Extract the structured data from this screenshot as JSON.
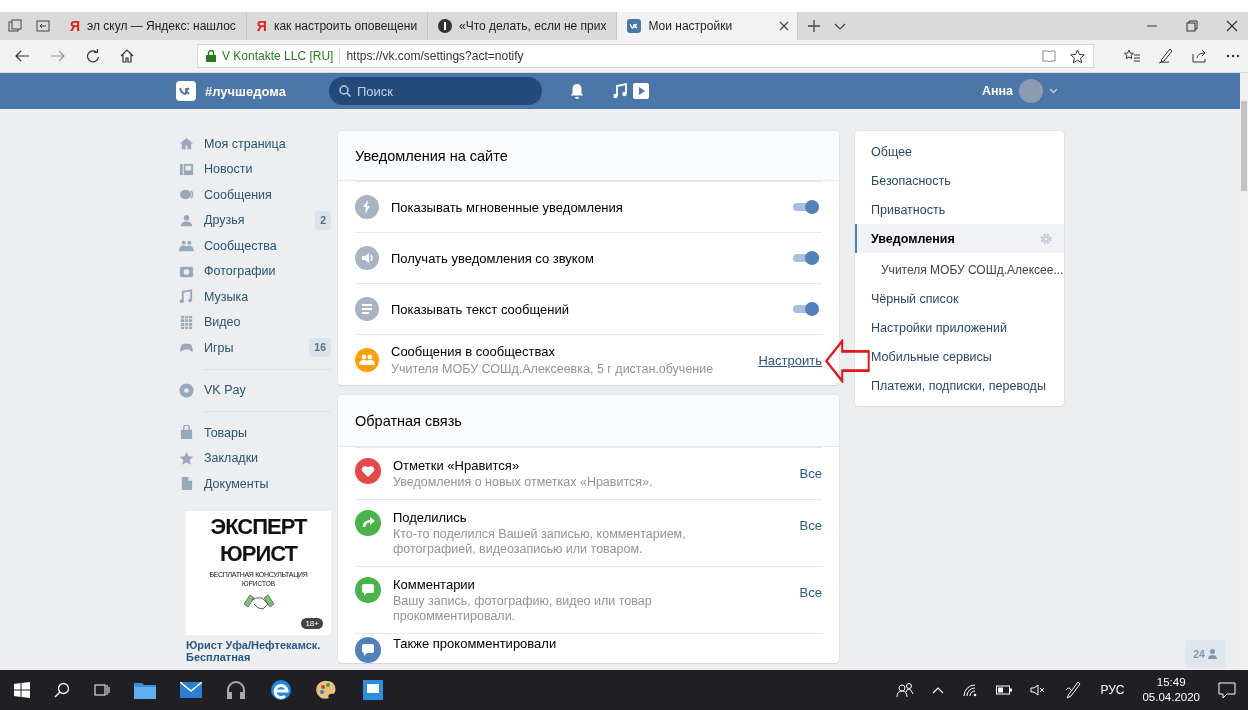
{
  "browser": {
    "tabs": [
      {
        "label": "эл скул — Яндекс: нашлос",
        "kind": "letter",
        "icon_text": "Я",
        "selected": false
      },
      {
        "label": "как настроить оповещени",
        "kind": "letter",
        "icon_text": "Я",
        "selected": false
      },
      {
        "label": "«Что делать, если не прих",
        "kind": "circle",
        "selected": false
      },
      {
        "label": "Мои настройки",
        "kind": "logo",
        "selected": true
      }
    ],
    "site_identity": "V Kontakte LLC [RU]",
    "url": "https://vk.com/settings?act=notify"
  },
  "header": {
    "brand": "#лучшедома",
    "search_placeholder": "Поиск",
    "user_name": "Анна"
  },
  "left_menu": {
    "groups": [
      [
        {
          "label": "Моя страница"
        },
        {
          "label": "Новости"
        },
        {
          "label": "Сообщения"
        },
        {
          "label": "Друзья",
          "count": "2"
        },
        {
          "label": "Сообщества"
        },
        {
          "label": "Фотографии"
        },
        {
          "label": "Музыка"
        },
        {
          "label": "Видео"
        },
        {
          "label": "Игры",
          "count": "16"
        }
      ],
      [
        {
          "label": "VK Pay"
        }
      ],
      [
        {
          "label": "Товары"
        },
        {
          "label": "Закладки"
        },
        {
          "label": "Документы"
        }
      ]
    ]
  },
  "ad": {
    "headline": "ЭКСПЕРТ",
    "headline_2": "ЮРИСТ",
    "tagline": "БЕСПЛАТНАЯ КОНСУЛЬТАЦИЯ",
    "tagline_2": "ЮРИСТОВ",
    "age_badge": "18+",
    "title": "Юрист Уфа/Нефтекамск.",
    "title_2": "Бесплатная"
  },
  "notifications": {
    "title": "Уведомления на сайте",
    "rows": [
      {
        "kind": "toggle",
        "color": "#a8b4c2",
        "title": "Показывать мгновенные уведомления",
        "on": true
      },
      {
        "kind": "toggle",
        "color": "#a8b4c2",
        "title": "Получать уведомления со звуком",
        "on": true
      },
      {
        "kind": "toggle",
        "color": "#a8b4c2",
        "title": "Показывать текст сообщений",
        "on": true
      },
      {
        "kind": "link",
        "color": "#ffa000",
        "title": "Сообщения в сообществах",
        "subtitle": "Учителя МОБУ СОШд.Алексеевка, 5 г дистан.обучение",
        "action": "Настроить"
      }
    ]
  },
  "feedback": {
    "title": "Обратная связь",
    "rows": [
      {
        "color": "#e64646",
        "title": "Отметки «Нравится»",
        "subtitle": "Уведомления о новых отметках «Нравится».",
        "action": "Все"
      },
      {
        "color": "#4bb34b",
        "title": "Поделились",
        "subtitle": "Кто-то поделился Вашей записью, комментарием, фотографией, видеозаписью или товаром.",
        "action": "Все"
      },
      {
        "color": "#4bb34b",
        "title": "Комментарии",
        "subtitle": "Вашу запись, фотографию, видео или товар прокомментировали.",
        "action": "Все"
      },
      {
        "color": "#5181b8",
        "title": "Также прокомментировали"
      }
    ]
  },
  "settings_menu": {
    "items": [
      {
        "kind": "item",
        "label": "Общее",
        "selected": false
      },
      {
        "kind": "item",
        "label": "Безопасность",
        "selected": false
      },
      {
        "kind": "item",
        "label": "Приватность",
        "selected": false
      },
      {
        "kind": "item",
        "label": "Уведомления",
        "selected": true
      },
      {
        "kind": "sub",
        "label": "Учителя МОБУ СОШд.Алексее...",
        "selected": false
      },
      {
        "kind": "item",
        "label": "Чёрный список",
        "selected": false
      },
      {
        "kind": "item",
        "label": "Настройки приложений",
        "selected": false
      },
      {
        "kind": "item",
        "label": "Мобильные сервисы",
        "selected": false
      },
      {
        "kind": "item",
        "label": "Платежи, подписки, переводы",
        "selected": false
      }
    ]
  },
  "online_count": "24",
  "taskbar": {
    "language": "РУС",
    "time": "15:49",
    "date": "05.04.2020"
  }
}
